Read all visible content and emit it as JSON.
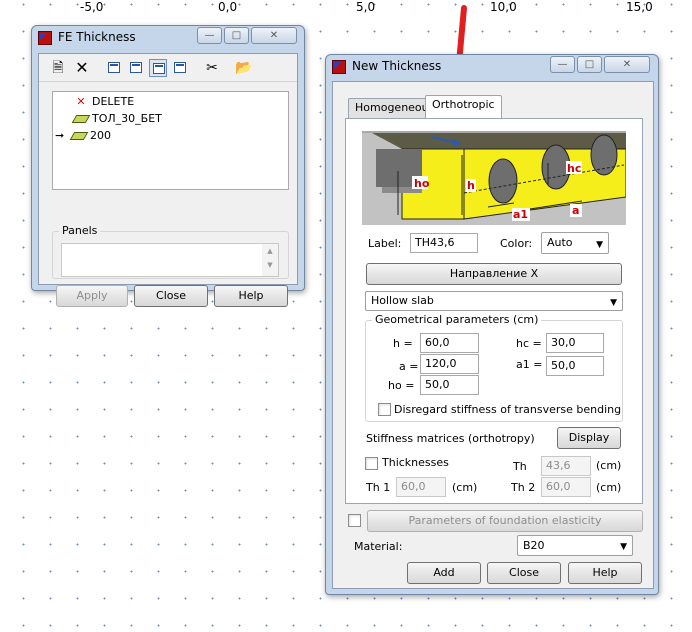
{
  "axis": {
    "ticks": [
      "-5,0",
      "0,0",
      "5,0",
      "10,0",
      "15,0"
    ]
  },
  "fe_window": {
    "title": "FE Thickness",
    "toolbar": [
      "new-icon",
      "delete-icon",
      "window-icon",
      "panel-icon",
      "grid-icon",
      "table-icon",
      "scissors-icon",
      "folder-star-icon"
    ],
    "tree": [
      {
        "label": "DELETE",
        "icon": "red-x-icon",
        "current": false
      },
      {
        "label": "ТОЛ_30_БЕТ",
        "icon": "layer-icon",
        "current": false
      },
      {
        "label": "200",
        "icon": "layer-icon",
        "current": true
      }
    ],
    "panels_label": "Panels",
    "buttons": {
      "apply": "Apply",
      "close": "Close",
      "help": "Help"
    }
  },
  "nt_window": {
    "title": "New Thickness",
    "tabs": [
      {
        "label": "Homogeneous",
        "active": false
      },
      {
        "label": "Orthotropic",
        "active": true
      }
    ],
    "diagram": {
      "h": "h",
      "ho": "ho",
      "hc": "hc",
      "a1": "a1",
      "a": "a"
    },
    "label_caption": "Label:",
    "label_value": "TH43,6",
    "color_caption": "Color:",
    "color_value": "Auto",
    "direction_button": "Направление X",
    "slab_type": "Hollow slab",
    "geom_title": "Geometrical parameters (cm)",
    "params": {
      "h_label": "h  =",
      "h_value": "60,0",
      "hc_label": "hc  =",
      "hc_value": "30,0",
      "a_label": "a  =",
      "a_value": "120,0",
      "a1_label": "a1  =",
      "a1_value": "50,0",
      "ho_label": "ho  =",
      "ho_value": "50,0"
    },
    "disregard_label": "Disregard stiffness of transverse bending",
    "stiffness_label": "Stiffness matrices (orthotropy)",
    "display_button": "Display",
    "thicknesses_label": "Thicknesses",
    "th_label": "Th",
    "th_value": "43,6",
    "th_unit": "(cm)",
    "th1_label": "Th 1",
    "th1_value": "60,0",
    "th1_unit": "(cm)",
    "th2_label": "Th 2",
    "th2_value": "60,0",
    "th2_unit": "(cm)",
    "foundation_button": "Parameters of foundation elasticity",
    "material_label": "Material:",
    "material_value": "B20",
    "buttons": {
      "add": "Add",
      "close": "Close",
      "help": "Help"
    }
  },
  "colors": {
    "arrow": "#e02020",
    "slab_yellow": "#f6ee1a",
    "accent": "#2a5bb0"
  }
}
